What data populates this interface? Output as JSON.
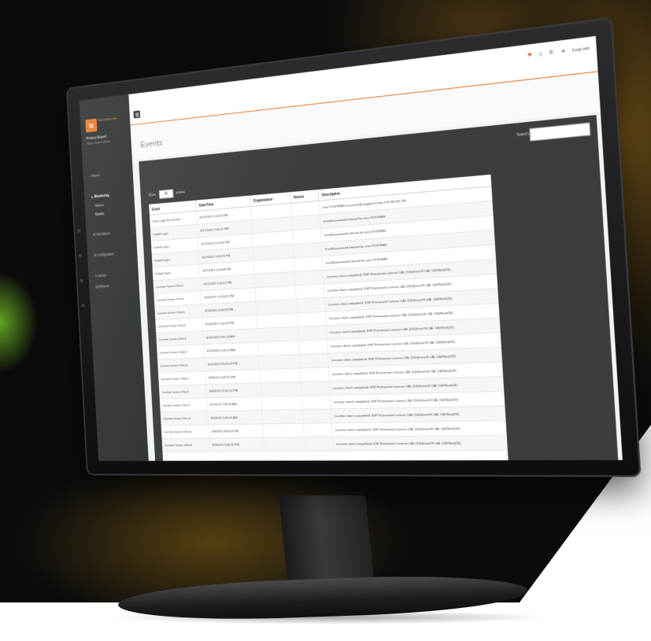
{
  "colors": {
    "accent": "#e8792b",
    "sidebar_bg": "#2f3331",
    "panel_bg": "#3b3e3c",
    "flag": "#d23b2a"
  },
  "brand": {
    "logo_text": "tz",
    "name_line": "Tiger Information"
  },
  "user": {
    "name": "Privacy Expert",
    "role": "Global System Admin"
  },
  "sidebar": {
    "items": [
      {
        "label": "Home",
        "icon": "home-icon"
      },
      {
        "label": "Monitoring",
        "icon": "monitor-icon",
        "active": true,
        "children": [
          {
            "label": "Alarms"
          },
          {
            "label": "Events",
            "selected": true
          }
        ]
      },
      {
        "label": "Operations",
        "icon": "operations-icon"
      },
      {
        "label": "Configuration",
        "icon": "configuration-icon"
      },
      {
        "label": "Admin",
        "icon": "admin-icon"
      },
      {
        "label": "Reports",
        "icon": "reports-icon"
      }
    ]
  },
  "topbar": {
    "menu_icon": "hamburger-icon",
    "flag_icon": "flag-icon",
    "device_icon": "device-icon",
    "phone_icon": "phone-icon",
    "logout_label": "Log out"
  },
  "page": {
    "title": "Events"
  },
  "search": {
    "label": "Search:"
  },
  "length_menu": {
    "prefix": "Show",
    "value": "25",
    "suffix": "entries"
  },
  "table": {
    "columns": [
      "Event",
      "Date/Time",
      "Organization",
      "Device",
      "Description"
    ],
    "rows": [
      [
        "User Login Successful",
        "6/17/2021 1:02:05 PM",
        "",
        "",
        "User SYSTEMS successfully logged in from 115.99.150.219"
      ],
      [
        "Failed Login",
        "6/17/2021 1:00:41 PM",
        "",
        "",
        "Invalid password entered for user SYSTEMS"
      ],
      [
        "Failed Login",
        "6/17/2021 1:00:31 PM",
        "",
        "",
        "Invalid password entered for user SYSTEMS"
      ],
      [
        "Failed Login",
        "6/17/2021 1:00:21 PM",
        "",
        "",
        "Invalid password entered for user SYSTEMS"
      ],
      [
        "Failed Login",
        "6/17/2021 1:00:08 PM",
        "",
        "",
        "Invalid password entered for user SYSTEMS"
      ],
      [
        "License Issues Check",
        "6/17/2021 1:00:07 PM",
        "",
        "",
        "License check completed: SSP Permanent License CAL (100)/next B CAL 100/Next(20)"
      ],
      [
        "License Issues Check",
        "6/16/2021 11:05:21 PM",
        "",
        "",
        "License check completed: SSP Permanent License CAL (100)/next B CAL 100/Next(20)"
      ],
      [
        "License Issues Check",
        "6/15/2021 6:45:33 PM",
        "",
        "",
        "License check completed: SSP Permanent License CAL (100)/next B CAL 100/Next(20)"
      ],
      [
        "License Issues Check",
        "6/14/2021 1:45:19 PM",
        "",
        "",
        "License check completed: SSP Permanent License CAL (100)/next B CAL 100/Next(20)"
      ],
      [
        "License Issues Check",
        "6/13/2021 9:45:16 AM",
        "",
        "",
        "License check completed: SSP Permanent License CAL (100)/next B CAL 100/Next(20)"
      ],
      [
        "License Issues Check",
        "6/12/2021 5:45:14 AM",
        "",
        "",
        "License check completed: SSP Permanent License CAL (100)/next B CAL 100/Next(20)"
      ],
      [
        "License Issues Check",
        "6/11/2021 10:45:18 PM",
        "",
        "",
        "License check completed: SSP Permanent License CAL (100)/next B CAL 100/Next(20)"
      ],
      [
        "License Issues Check",
        "6/9/2021 6:45:14 PM",
        "",
        "",
        "License check completed: SSP Permanent License CAL (100)/next B CAL 100/Next(20)"
      ],
      [
        "License Issues Check",
        "6/8/2021 12:45:12 PM",
        "",
        "",
        "License check completed: SSP Permanent License CAL (100)/next B CAL 100/Next(20)"
      ],
      [
        "License Issues Check",
        "6/7/2021 7:45:13 AM",
        "",
        "",
        "License check completed: SSP Permanent License CAL (100)/next B CAL 100/Next(20)"
      ],
      [
        "License Issues Check",
        "6/6/2021 2:45:12 AM",
        "",
        "",
        "License check completed: SSP Permanent License CAL (100)/next B CAL 100/Next(20)"
      ],
      [
        "License Issues Check",
        "6/4/2021 9:45:13 PM",
        "",
        "",
        "License check completed: SSP Permanent License CAL (100)/next B CAL 100/Next(20)"
      ],
      [
        "License Issues Check",
        "6/3/2021 4:45:12 PM",
        "",
        "",
        "License check completed: SSP Permanent License CAL (100)/next B CAL 100/Next(20)"
      ]
    ]
  }
}
